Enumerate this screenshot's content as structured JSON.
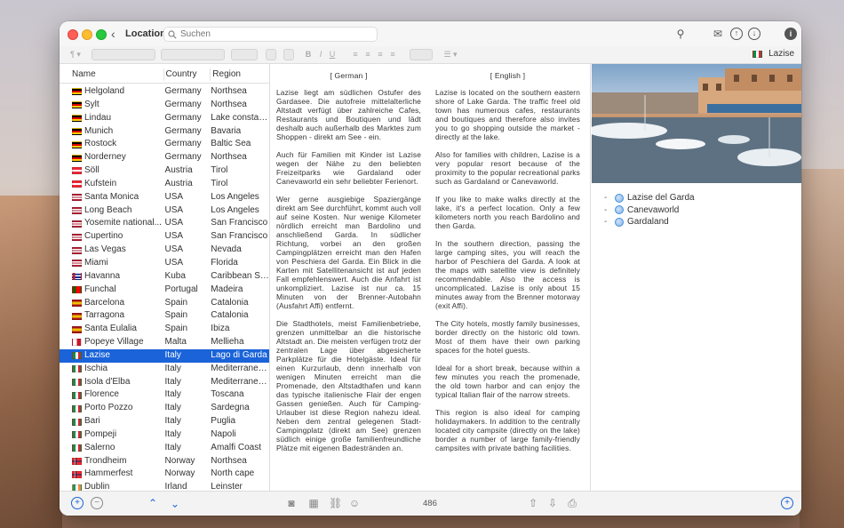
{
  "window": {
    "title": "Locations",
    "search_placeholder": "Suchen",
    "current_location": "Lazise"
  },
  "columns": {
    "name": "Name",
    "country": "Country",
    "region": "Region"
  },
  "rows": [
    {
      "name": "Helgoland",
      "country": "Germany",
      "region": "Northsea",
      "flag": "de"
    },
    {
      "name": "Sylt",
      "country": "Germany",
      "region": "Northsea",
      "flag": "de"
    },
    {
      "name": "Lindau",
      "country": "Germany",
      "region": "Lake constance",
      "flag": "de"
    },
    {
      "name": "Munich",
      "country": "Germany",
      "region": "Bavaria",
      "flag": "de"
    },
    {
      "name": "Rostock",
      "country": "Germany",
      "region": "Baltic Sea",
      "flag": "de"
    },
    {
      "name": "Norderney",
      "country": "Germany",
      "region": "Northsea",
      "flag": "de"
    },
    {
      "name": "Söll",
      "country": "Austria",
      "region": "Tirol",
      "flag": "at"
    },
    {
      "name": "Kufstein",
      "country": "Austria",
      "region": "Tirol",
      "flag": "at"
    },
    {
      "name": "Santa Monica",
      "country": "USA",
      "region": "Los Angeles",
      "flag": "us"
    },
    {
      "name": "Long Beach",
      "country": "USA",
      "region": "Los Angeles",
      "flag": "us"
    },
    {
      "name": "Yosemite national...",
      "country": "USA",
      "region": "San Francisco",
      "flag": "us"
    },
    {
      "name": "Cupertino",
      "country": "USA",
      "region": "San Francisco",
      "flag": "us"
    },
    {
      "name": "Las Vegas",
      "country": "USA",
      "region": "Nevada",
      "flag": "us"
    },
    {
      "name": "Miami",
      "country": "USA",
      "region": "Florida",
      "flag": "us"
    },
    {
      "name": "Havanna",
      "country": "Kuba",
      "region": "Caribbean Sea",
      "flag": "cu"
    },
    {
      "name": "Funchal",
      "country": "Portugal",
      "region": "Madeira",
      "flag": "pt"
    },
    {
      "name": "Barcelona",
      "country": "Spain",
      "region": "Catalonia",
      "flag": "es"
    },
    {
      "name": "Tarragona",
      "country": "Spain",
      "region": "Catalonia",
      "flag": "es"
    },
    {
      "name": "Santa Eulalia",
      "country": "Spain",
      "region": "Ibiza",
      "flag": "es"
    },
    {
      "name": "Popeye Village",
      "country": "Malta",
      "region": "Mellieha",
      "flag": "mt"
    },
    {
      "name": "Lazise",
      "country": "Italy",
      "region": "Lago di Garda",
      "flag": "it",
      "selected": true
    },
    {
      "name": "Ischia",
      "country": "Italy",
      "region": "Mediterranean...",
      "flag": "it"
    },
    {
      "name": "Isola d'Elba",
      "country": "Italy",
      "region": "Mediterranean...",
      "flag": "it"
    },
    {
      "name": "Florence",
      "country": "Italy",
      "region": "Toscana",
      "flag": "it"
    },
    {
      "name": "Porto Pozzo",
      "country": "Italy",
      "region": "Sardegna",
      "flag": "it"
    },
    {
      "name": "Bari",
      "country": "Italy",
      "region": "Puglia",
      "flag": "it"
    },
    {
      "name": "Pompeji",
      "country": "Italy",
      "region": "Napoli",
      "flag": "it"
    },
    {
      "name": "Salerno",
      "country": "Italy",
      "region": "Amalfi Coast",
      "flag": "it"
    },
    {
      "name": "Trondheim",
      "country": "Norway",
      "region": "Northsea",
      "flag": "no"
    },
    {
      "name": "Hammerfest",
      "country": "Norway",
      "region": "North cape",
      "flag": "no"
    },
    {
      "name": "Dublin",
      "country": "Irland",
      "region": "Leinster",
      "flag": "ie"
    }
  ],
  "german": {
    "heading": "[ German ]",
    "paragraphs": [
      "Lazise liegt am südlichen Ostufer des Gardasee. Die autofreie mittelalterliche Altstadt verfügt über zahlreiche Cafes, Restaurants und Boutiquen und lädt deshalb auch außerhalb des Marktes zum Shoppen - direkt am See - ein.",
      "Auch für Familien mit Kinder ist Lazise wegen der Nähe zu den beliebten Freizeitparks wie Gardaland oder Canevaworld ein sehr beliebter Ferienort.",
      "Wer gerne ausgiebige Spaziergänge direkt am See durchführt, kommt auch voll auf seine Kosten. Nur wenige Kilometer nördlich erreicht man Bardolino und anschließend Garda. In südlicher Richtung, vorbei an den großen Campingplätzen erreicht man den Hafen von Peschiera del Garda. Ein Blick in die Karten mit Satellitenansicht ist auf jeden Fall empfehlenswert. Auch die Anfahrt ist unkompliziert. Lazise ist nur ca. 15 Minuten von der Brenner-Autobahn (Ausfahrt Affi) entfernt.",
      "Die Stadthotels, meist Familienbetriebe, grenzen unmittelbar an die historische Altstadt an. Die meisten verfügen trotz der zentralen Lage über abgesicherte Parkplätze für die Hotelgäste. Ideal für einen Kurzurlaub, denn innerhalb von wenigen Minuten erreicht man die Promenade, den Altstadthafen und kann das typische italienische Flair der engen Gassen genießen. Auch für Camping-Urlauber ist diese Region nahezu ideal. Neben dem zentral gelegenen Stadt-Campingplatz (direkt am See) grenzen südlich einige große familienfreundliche Plätze mit eigenen Badestränden an."
    ]
  },
  "english": {
    "heading": "[ English ]",
    "paragraphs": [
      "Lazise is located on the southern eastern shore of Lake Garda. The traffic freel old town has numerous cafes, restaurants and boutiques and therefore also invites you to go shopping outside the market - directly at the lake.",
      "Also for families with children, Lazise is a very popular resort because of the proximity to the popular recreational parks such as Gardaland or Canevaworld.",
      "If you like to make walks directly at the lake, it's a perfect location. Only a few kilometers north you reach Bardolino and then Garda.",
      "In the southern direction, passing the large camping sites, you will reach the harbor of Peschiera del Garda. A look at the maps with satellite view is definitely recommendable. Also the access is uncomplicated. Lazise is only about 15 minutes away from the Brenner motorway (exit Affi).",
      "The City hotels, mostly family businesses, border directly on the historic old town. Most of them have their own parking spaces for the hotel guests.",
      "Ideal for a short break, because within a few minutes you reach the promenade, the old town harbor and can enjoy the typical Italian flair of the narrow streets.",
      "This region is also ideal for camping holidaymakers. In addition to the centrally located city campsite (directly on the lake) border a number of large family-friendly campsites with private bathing facilities."
    ]
  },
  "tags": [
    "Lazise del Garda",
    "Canevaworld",
    "Gardaland"
  ],
  "word_count": "486",
  "icons": {
    "back": "chevron-left-icon",
    "search": "search-icon",
    "pin": "pin-icon",
    "mail": "mail-icon",
    "upload": "arrow-up-circle-icon",
    "download": "arrow-down-circle-icon",
    "info": "info-icon",
    "add": "plus-circle-icon",
    "remove": "minus-circle-icon",
    "camera": "camera-icon",
    "table": "table-icon",
    "link": "link-icon",
    "emoji": "smiley-icon",
    "share": "share-icon",
    "import": "import-icon",
    "print": "printer-icon"
  },
  "colors": {
    "selection": "#1a63d9",
    "accent": "#1a63d9"
  }
}
